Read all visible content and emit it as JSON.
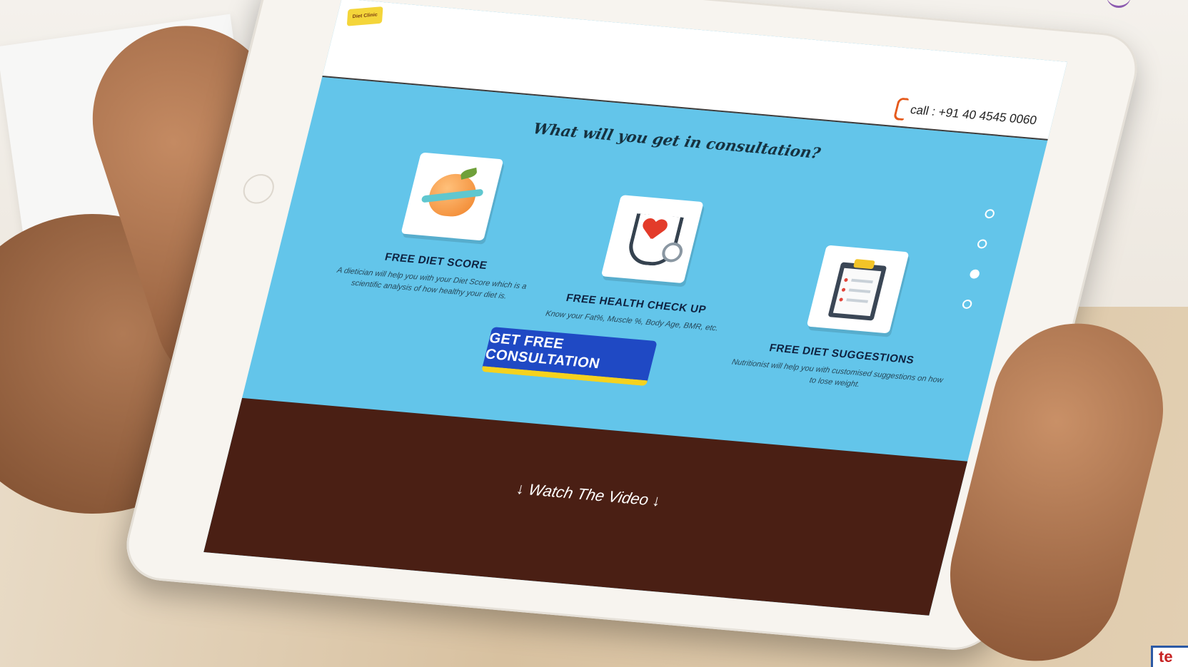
{
  "page": {
    "logo_text": "Diet Clinic",
    "call_label": "call : +91 40 4545 0060",
    "heading": "What will you get in consultation?",
    "features": [
      {
        "title": "FREE DIET SCORE",
        "description": "A dietician will help you with your Diet Score which is a scientific analysis of how healthy your diet is.",
        "icon": "apple-measuring-tape-icon"
      },
      {
        "title": "FREE HEALTH CHECK UP",
        "description": "Know your Fat%, Muscle %, Body Age, BMR, etc.",
        "icon": "stethoscope-heart-icon"
      },
      {
        "title": "FREE DIET SUGGESTIONS",
        "description": "Nutritionist will help you with customised suggestions on how to lose weight.",
        "icon": "clipboard-icon"
      }
    ],
    "cta_label": "GET FREE CONSULTATION",
    "carousel_active_index": 2,
    "watch_video": "↓ Watch The Video ↓"
  },
  "watermark_text": "te",
  "colors": {
    "screen_bg": "#63c5ea",
    "cta_bg": "#1f49c4",
    "cta_accent": "#f5d21e",
    "footer_bg": "#4a1f14",
    "phone_icon": "#e55a1c"
  }
}
